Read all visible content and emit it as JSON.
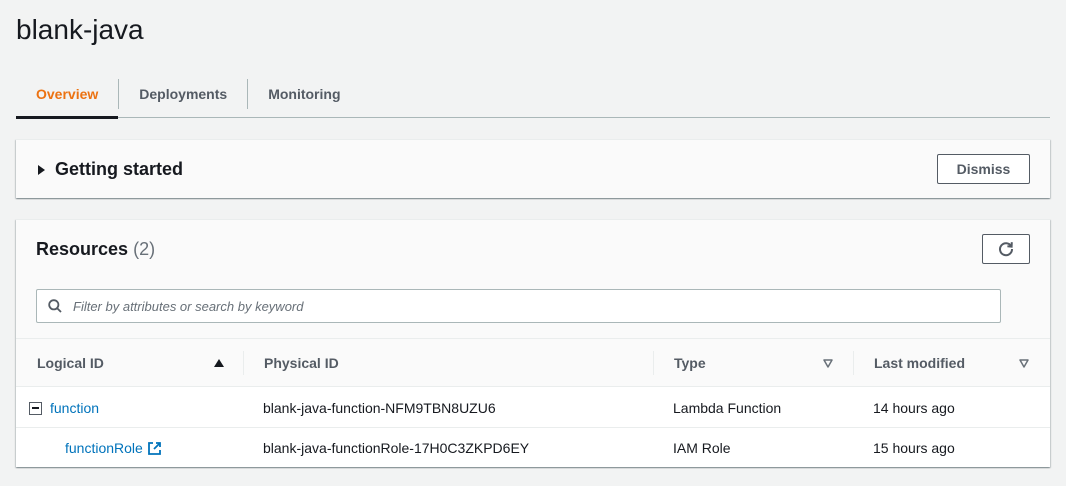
{
  "page": {
    "title": "blank-java"
  },
  "tabs": [
    {
      "label": "Overview",
      "active": true
    },
    {
      "label": "Deployments",
      "active": false
    },
    {
      "label": "Monitoring",
      "active": false
    }
  ],
  "getting_started": {
    "title": "Getting started",
    "dismiss_label": "Dismiss"
  },
  "resources": {
    "title": "Resources",
    "count": "(2)",
    "search_placeholder": "Filter by attributes or search by keyword",
    "columns": [
      "Logical ID",
      "Physical ID",
      "Type",
      "Last modified"
    ],
    "rows": [
      {
        "logical_id": "function",
        "physical_id": "blank-java-function-NFM9TBN8UZU6",
        "type": "Lambda Function",
        "last_modified": "14 hours ago"
      },
      {
        "logical_id": "functionRole",
        "physical_id": "blank-java-functionRole-17H0C3ZKPD6EY",
        "type": "IAM Role",
        "last_modified": "15 hours ago"
      }
    ]
  },
  "colors": {
    "accent": "#ec7211",
    "link": "#0073bb",
    "text": "#16191f"
  },
  "icons": [
    "caret-right-icon",
    "refresh-icon",
    "search-icon",
    "sort-ascending-icon",
    "sort-descending-icon",
    "collapse-icon",
    "external-link-icon"
  ]
}
